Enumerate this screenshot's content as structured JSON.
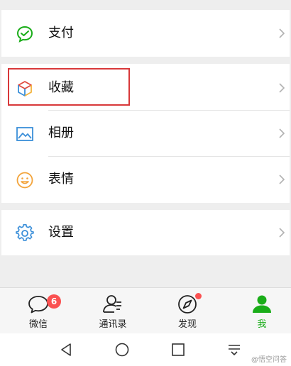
{
  "menu": {
    "pay": {
      "label": "支付",
      "icon": "wallet-icon",
      "color": "#1aad19"
    },
    "favorites": {
      "label": "收藏",
      "icon": "cube-icon"
    },
    "album": {
      "label": "相册",
      "icon": "picture-icon",
      "color": "#3b8fd9"
    },
    "stickers": {
      "label": "表情",
      "icon": "smiley-icon",
      "color": "#f3a43b"
    },
    "settings": {
      "label": "设置",
      "icon": "gear-icon",
      "color": "#3b8fd9"
    }
  },
  "highlight_color": "#d8383a",
  "tabs": [
    {
      "label": "微信",
      "icon": "chat-bubble-icon",
      "badge": "6"
    },
    {
      "label": "通讯录",
      "icon": "contacts-icon"
    },
    {
      "label": "发现",
      "icon": "compass-icon",
      "dot": true
    },
    {
      "label": "我",
      "icon": "person-icon",
      "active": true
    }
  ],
  "accent_color": "#1aad19",
  "badge_color": "#fa5151",
  "system_nav": [
    "back-icon",
    "home-icon",
    "recents-icon",
    "menu-icon"
  ],
  "watermark": "@悟空问答"
}
